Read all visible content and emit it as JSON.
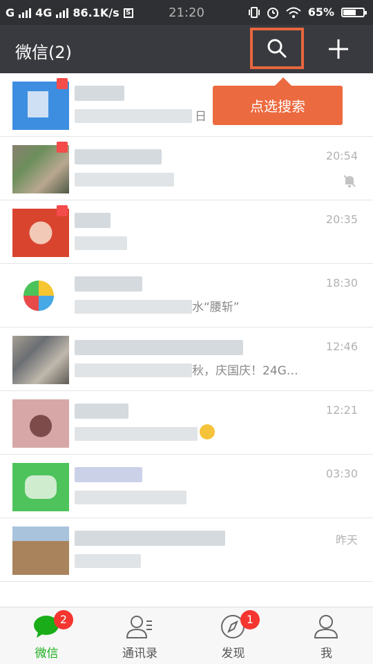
{
  "status_bar": {
    "network_label": "G",
    "network2_label": "4G",
    "speed": "86.1K/s",
    "time": "21:20",
    "battery": "65%",
    "battery_level": 0.65
  },
  "header": {
    "title": "微信(2)",
    "tooltip": "点选搜索",
    "accent_color": "#e8663e"
  },
  "chats": [
    {
      "time": "",
      "preview_tail": "日",
      "muted": false
    },
    {
      "time": "20:54",
      "preview_tail": "",
      "muted": true
    },
    {
      "time": "20:35",
      "preview_tail": "",
      "muted": false
    },
    {
      "time": "18:30",
      "preview_tail": "水“腰斩”",
      "muted": false
    },
    {
      "time": "12:46",
      "preview_tail": "秋，庆国庆！24G…",
      "muted": false
    },
    {
      "time": "12:21",
      "preview_tail": "",
      "muted": false
    },
    {
      "time": "03:30",
      "preview_tail": "",
      "muted": false
    },
    {
      "time": "昨天",
      "preview_tail": "",
      "muted": false
    }
  ],
  "tabbar": {
    "chats": {
      "label": "微信",
      "badge": "2"
    },
    "contacts": {
      "label": "通讯录"
    },
    "discover": {
      "label": "发现",
      "badge": "1"
    },
    "me": {
      "label": "我"
    }
  },
  "colors": {
    "active": "#1aad19",
    "badge": "#f43530"
  }
}
